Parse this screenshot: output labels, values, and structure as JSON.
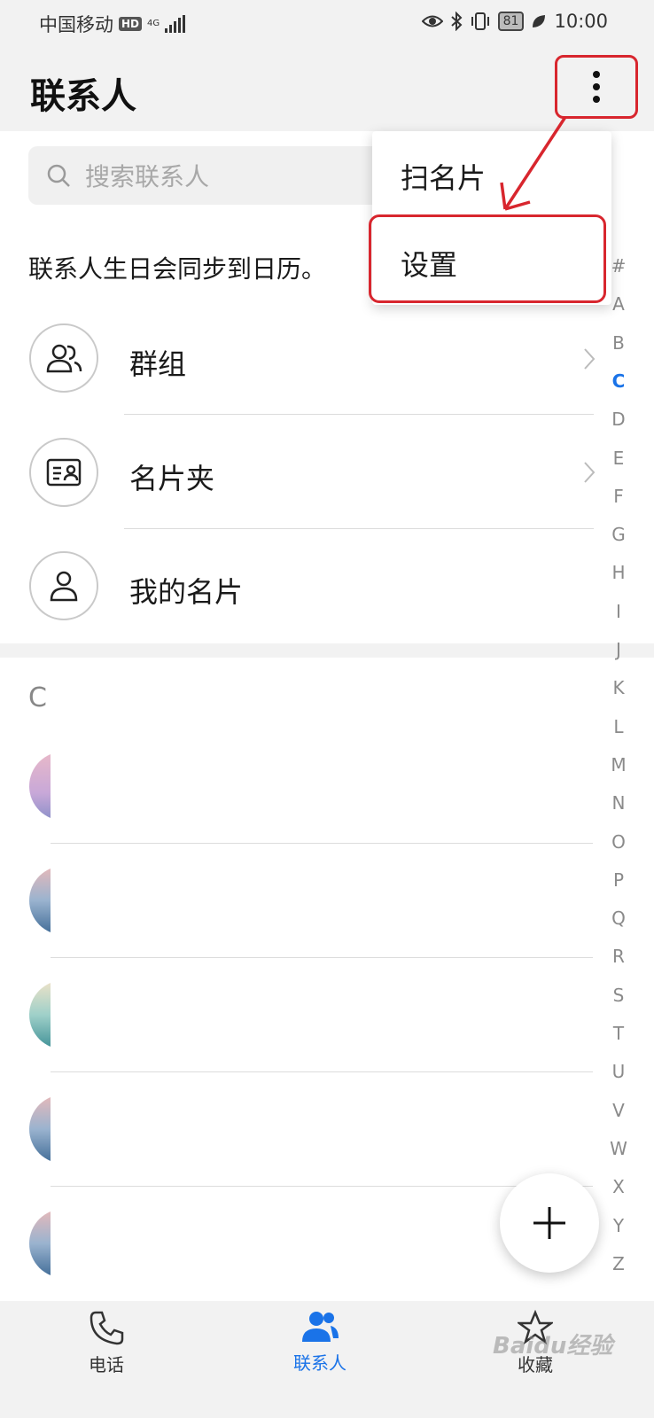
{
  "status_bar": {
    "carrier": "中国移动",
    "hd": "HD",
    "network": "4G",
    "battery": "81",
    "time": "10:00"
  },
  "header": {
    "title": "联系人",
    "more_icon": "more-vertical-icon"
  },
  "search": {
    "placeholder": "搜索联系人"
  },
  "sync_notice": "联系人生日会同步到日历。",
  "menu": {
    "items": [
      {
        "label": "群组",
        "icon": "group-icon"
      },
      {
        "label": "名片夹",
        "icon": "card-holder-icon"
      },
      {
        "label": "我的名片",
        "icon": "person-icon"
      }
    ]
  },
  "popup_menu": {
    "items": [
      {
        "label": "扫名片"
      },
      {
        "label": "设置"
      }
    ]
  },
  "contacts": {
    "section_letter": "C"
  },
  "index": {
    "letters": [
      "#",
      "A",
      "B",
      "C",
      "D",
      "E",
      "F",
      "G",
      "H",
      "I",
      "J",
      "K",
      "L",
      "M",
      "N",
      "O",
      "P",
      "Q",
      "R",
      "S",
      "T",
      "U",
      "V",
      "W",
      "X",
      "Y",
      "Z"
    ],
    "active": "C"
  },
  "fab": {
    "icon": "add-icon"
  },
  "bottom_nav": {
    "items": [
      {
        "label": "电话",
        "icon": "phone-icon"
      },
      {
        "label": "联系人",
        "icon": "contacts-icon",
        "active": true
      },
      {
        "label": "收藏",
        "icon": "star-icon"
      }
    ]
  },
  "watermark": "Baidu经验",
  "colors": {
    "accent": "#1a73e8",
    "annotation_red": "#d8262e"
  }
}
